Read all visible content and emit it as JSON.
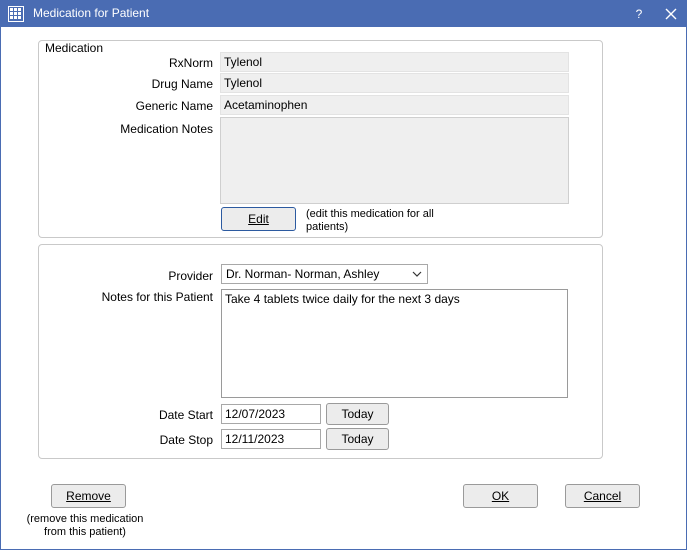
{
  "window": {
    "title": "Medication for Patient",
    "help_glyph": "?",
    "close_glyph": "✕"
  },
  "medication": {
    "group_title": "Medication",
    "rxnorm_label": "RxNorm",
    "rxnorm_value": "Tylenol",
    "drug_name_label": "Drug Name",
    "drug_name_value": "Tylenol",
    "generic_name_label": "Generic Name",
    "generic_name_value": "Acetaminophen",
    "notes_label": "Medication Notes",
    "notes_value": "",
    "edit_button": "Edit",
    "edit_note_line1": "(edit this medication for all",
    "edit_note_line2": "patients)"
  },
  "patient": {
    "provider_label": "Provider",
    "provider_value": "Dr. Norman- Norman, Ashley",
    "notes_label": "Notes for this Patient",
    "notes_value": "Take 4 tablets twice daily for the next 3 days",
    "date_start_label": "Date Start",
    "date_start_value": "12/07/2023",
    "date_stop_label": "Date Stop",
    "date_stop_value": "12/11/2023",
    "today_label": "Today"
  },
  "footer": {
    "remove_button": "Remove",
    "remove_note_line1": "(remove this medication",
    "remove_note_line2": "from this patient)",
    "ok_button": "OK",
    "cancel_button": "Cancel"
  },
  "icons": [
    "app-grid-icon",
    "help-icon",
    "close-icon",
    "chevron-down-icon"
  ]
}
